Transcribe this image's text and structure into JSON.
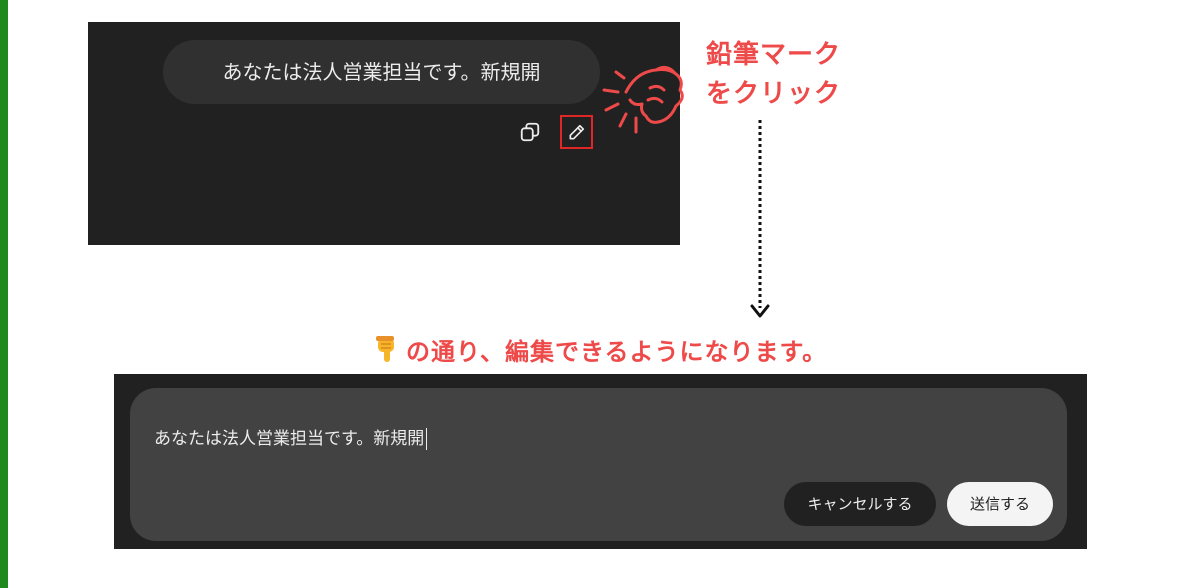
{
  "top_panel": {
    "message": "あなたは法人営業担当です。新規開",
    "icons": [
      "copy-icon",
      "pencil-icon"
    ]
  },
  "annotation": {
    "callout_line1": "鉛筆マーク",
    "callout_line2": "をクリック",
    "caption": "の通り、編集できるようになります。",
    "caption_icon": "backhand-index-pointing-down-icon",
    "accent_color": "#ee4a4a"
  },
  "bottom_panel": {
    "editor_value": "あなたは法人営業担当です。新規開",
    "cancel_label": "キャンセルする",
    "send_label": "送信する"
  },
  "colors": {
    "panel_bg": "#212121",
    "bubble_bg": "#303030",
    "editor_bg": "#424242",
    "highlight_border": "#e02727",
    "left_bar": "#1e8a1e"
  }
}
